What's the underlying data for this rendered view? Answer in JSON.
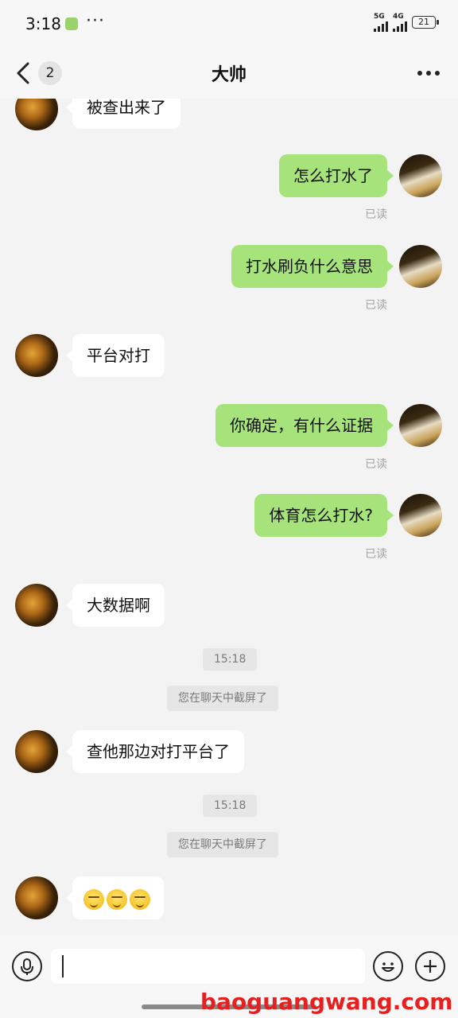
{
  "status_bar": {
    "time": "3:18",
    "more_indicator": "···",
    "signal_5g": "5G",
    "signal_4g": "4G",
    "battery": "21"
  },
  "header": {
    "unread_count": "2",
    "title": "大帅",
    "more_icon": "more-dots-icon"
  },
  "messages": [
    {
      "side": "in",
      "text": "被查出来了"
    },
    {
      "side": "out",
      "text": "怎么打水了",
      "status": "已读"
    },
    {
      "side": "out",
      "text": "打水刷负什么意思",
      "status": "已读"
    },
    {
      "side": "in",
      "text": "平台对打"
    },
    {
      "side": "out",
      "text": "你确定，有什么证据",
      "status": "已读"
    },
    {
      "side": "out",
      "text": "体育怎么打水?",
      "status": "已读"
    },
    {
      "side": "in",
      "text": "大数据啊"
    },
    {
      "type": "time",
      "text": "15:18"
    },
    {
      "type": "system",
      "text": "您在聊天中截屏了"
    },
    {
      "side": "in",
      "text": "查他那边对打平台了"
    },
    {
      "type": "time",
      "text": "15:18"
    },
    {
      "type": "system",
      "text": "您在聊天中截屏了"
    },
    {
      "side": "in",
      "emoji": [
        "grimace-face",
        "grimace-face",
        "grimace-face"
      ]
    }
  ],
  "input_bar": {
    "value": "",
    "voice_icon": "microphone-icon",
    "emoji_icon": "smiley-icon",
    "plus_icon": "plus-icon"
  },
  "watermark": "baoguangwang.com",
  "colors": {
    "outgoing_bubble": "#a7e37b",
    "incoming_bubble": "#ffffff",
    "background": "#f3f3f3",
    "watermark": "#e61f1f"
  }
}
